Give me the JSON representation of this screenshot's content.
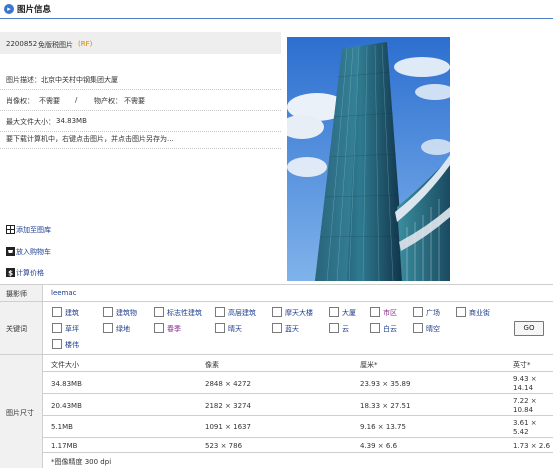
{
  "header": {
    "title": "图片信息"
  },
  "info": {
    "id": "2200852",
    "type": "免版税图片",
    "type_code": "(RF)",
    "description": "图片描述：北京中关村中钢集团大厦",
    "portrait_label": "肖像权：",
    "portrait_value": "不需要",
    "separator": "/",
    "property_label": "物产权：",
    "property_value": "不需要",
    "max_size_label": "最大文件大小：",
    "max_size_value": "34.83MB",
    "download_hint": "要下载计算机中，右键点击图片，并点击图片另存为..."
  },
  "actions": {
    "add_to_gallery": "添加至图库",
    "add_to_cart": "放入购物车",
    "calc_price": "计算价格"
  },
  "photographer": {
    "label": "摄影师",
    "name": "leemac"
  },
  "keywords": {
    "label": "关键词",
    "go_label": "GO",
    "items": [
      "建筑",
      "建筑物",
      "标志性建筑",
      "高层建筑",
      "摩天大楼",
      "大厦",
      "市区",
      "广场",
      "商业街",
      "草坪",
      "绿地",
      "春季",
      "晴天",
      "蓝天",
      "云",
      "白云",
      "晴空",
      "楼伟"
    ]
  },
  "sizes": {
    "label": "图片尺寸",
    "headers": [
      "文件大小",
      "像素",
      "厘米*",
      "英寸*"
    ],
    "rows": [
      [
        "34.83MB",
        "2848 × 4272",
        "23.93 × 35.89",
        "9.43 ×\n14.14"
      ],
      [
        "20.43MB",
        "2182 × 3274",
        "18.33 × 27.51",
        "7.22 ×\n10.84"
      ],
      [
        "5.1MB",
        "1091 × 1637",
        "9.16 × 13.75",
        "3.61 ×\n5.42"
      ],
      [
        "1.17MB",
        "523 × 786",
        "4.39 × 6.6",
        "1.73 × 2.6"
      ]
    ],
    "note": "*图像精度 300 dpi"
  }
}
